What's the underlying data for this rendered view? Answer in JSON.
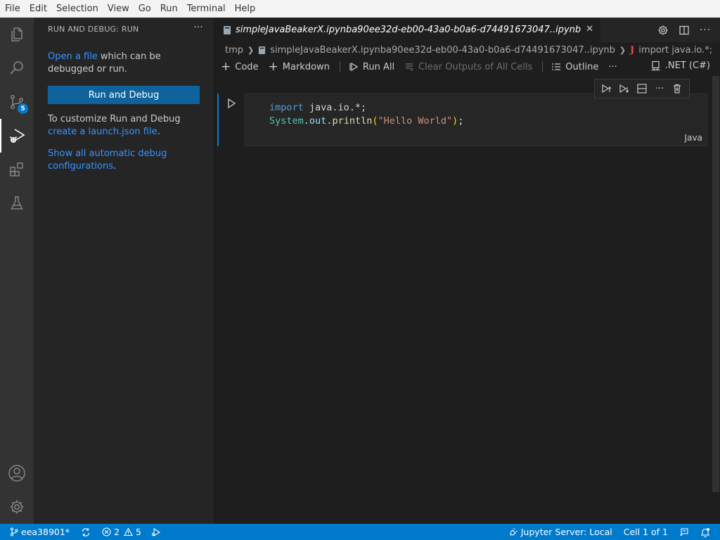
{
  "menu": [
    "File",
    "Edit",
    "Selection",
    "View",
    "Go",
    "Run",
    "Terminal",
    "Help"
  ],
  "activity_bar": {
    "source_control_badge": "5"
  },
  "sidebar": {
    "title": "RUN AND DEBUG: RUN",
    "open_file_link": "Open a file",
    "open_file_rest": " which can be debugged or run.",
    "run_debug_button": "Run and Debug",
    "customize_text": "To customize Run and Debug ",
    "launch_link": "create a launch.json file",
    "launch_rest": ".",
    "show_all_link": "Show all automatic debug configurations",
    "show_all_rest": "."
  },
  "tab": {
    "label": "simpleJavaBeakerX.ipynba90ee32d-eb00-43a0-b0a6-d74491673047..ipynb"
  },
  "breadcrumb": {
    "folder": "tmp",
    "file": "simpleJavaBeakerX.ipynba90ee32d-eb00-43a0-b0a6-d74491673047..ipynb",
    "symbol": "import java.io.*;"
  },
  "toolbar": {
    "code": "Code",
    "markdown": "Markdown",
    "run_all": "Run All",
    "clear_outputs": "Clear Outputs of All Cells",
    "outline": "Outline",
    "more": "···",
    "kernel": ".NET (C#)"
  },
  "cell": {
    "line1_kw": "import",
    "line1_rest": " java.io.*;",
    "line2_cls": "System",
    "line2_dot1": ".",
    "line2_var": "out",
    "line2_dot2": ".",
    "line2_fn": "println",
    "line2_open": "(",
    "line2_str": "\"Hello World\"",
    "line2_close": ")",
    "line2_end": ";",
    "language": "Java"
  },
  "statusbar": {
    "branch": "eea38901*",
    "errors": "2",
    "warnings": "5",
    "jupyter": "Jupyter Server: Local",
    "cell_position": "Cell 1 of 1"
  },
  "colors": {
    "accent": "#007acc",
    "button": "#0e639c",
    "link": "#3794ff"
  }
}
